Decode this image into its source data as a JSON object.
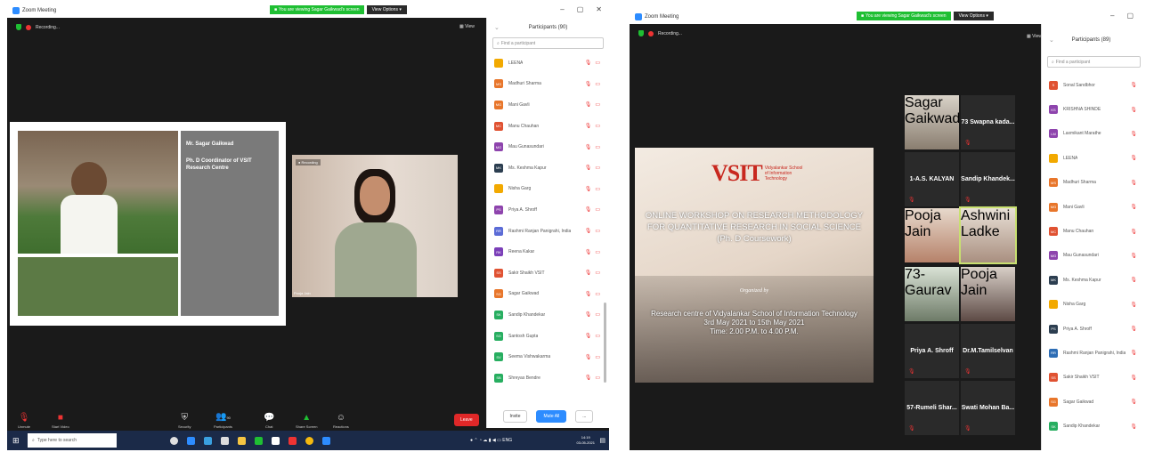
{
  "left": {
    "app_title": "Zoom Meeting",
    "share_banner": "You are viewing Sagar Gaikwad's screen",
    "view_options": "View Options",
    "recording": "Recording...",
    "view_btn": "View",
    "panel_title": "Participants (90)",
    "search_placeholder": "Find a participant",
    "participants": [
      {
        "initials": "",
        "name": "LEENA",
        "color": "#f2a900"
      },
      {
        "initials": "MS",
        "name": "Madhuri Sharma",
        "color": "#e8762b"
      },
      {
        "initials": "MG",
        "name": "Mani Gavli",
        "color": "#e8762b"
      },
      {
        "initials": "MC",
        "name": "Manu Chauhan",
        "color": "#e05232"
      },
      {
        "initials": "MG",
        "name": "Mau Gunasundari",
        "color": "#8e44ad"
      },
      {
        "initials": "MK",
        "name": "Ms. Keshma Kapur",
        "color": "#2c3e50"
      },
      {
        "initials": "",
        "name": "Nisha Garg",
        "color": "#f2a900"
      },
      {
        "initials": "PS",
        "name": "Priya A. Shroff",
        "color": "#8e44ad"
      },
      {
        "initials": "RR",
        "name": "Rashmi Ranjan Panigrahi, India",
        "color": "#5b6bd6"
      },
      {
        "initials": "RK",
        "name": "Reena Kakar",
        "color": "#7b3fb8"
      },
      {
        "initials": "SS",
        "name": "Sakir Shaikh VSIT",
        "color": "#e05232"
      },
      {
        "initials": "SG",
        "name": "Sagar Gaikwad",
        "color": "#e8762b"
      },
      {
        "initials": "SK",
        "name": "Sandip Khandekar",
        "color": "#27ae60"
      },
      {
        "initials": "SG",
        "name": "Santosh Gupta",
        "color": "#27ae60"
      },
      {
        "initials": "SV",
        "name": "Seema Vishwakarma",
        "color": "#27ae60"
      },
      {
        "initials": "SB",
        "name": "Shreyas Bendre",
        "color": "#27ae60"
      }
    ],
    "invite": "Invite",
    "mute_all": "Mute All",
    "more": "...",
    "speaker_name": "Mr. Sagar Gaikwad",
    "speaker_title": "Ph. D Coordinator of VSIT Research Centre",
    "pooja_label": "Pooja Jain",
    "toolbar": {
      "mute": "Unmute",
      "video": "Start Video",
      "security": "Security",
      "participants": "Participants",
      "participants_count": "90",
      "chat": "Chat",
      "share": "Share Screen",
      "reactions": "Reactions",
      "leave": "Leave"
    },
    "taskbar_search": "Type here to search",
    "clock_time": "14:19",
    "clock_date": "03-05-2021"
  },
  "right": {
    "app_title": "Zoom Meeting",
    "share_banner": "You are viewing Sagar Gaikwad's screen",
    "view_options": "View Options",
    "recording": "Recording...",
    "view_btn": "View",
    "panel_title": "Participants (89)",
    "search_placeholder": "Find a participant",
    "participants": [
      {
        "initials": "S",
        "name": "Sonal Sandbhor",
        "color": "#e05232"
      },
      {
        "initials": "KS",
        "name": "KRISHNA SHINDE",
        "color": "#8e44ad"
      },
      {
        "initials": "LM",
        "name": "Laxmikant Marathe",
        "color": "#8e44ad"
      },
      {
        "initials": "",
        "name": "LEENA",
        "color": "#f2a900"
      },
      {
        "initials": "MS",
        "name": "Madhuri Sharma",
        "color": "#e8762b"
      },
      {
        "initials": "MG",
        "name": "Mani Gavli",
        "color": "#e8762b"
      },
      {
        "initials": "MC",
        "name": "Manu Chauhan",
        "color": "#e05232"
      },
      {
        "initials": "MG",
        "name": "Mau Gunasundari",
        "color": "#8e44ad"
      },
      {
        "initials": "MK",
        "name": "Ms. Keshma Kapur",
        "color": "#2c3e50"
      },
      {
        "initials": "",
        "name": "Nisha Garg",
        "color": "#f2a900"
      },
      {
        "initials": "PS",
        "name": "Priya A. Shroff",
        "color": "#2c3e50"
      },
      {
        "initials": "RR",
        "name": "Rashmi Ranjan Panigrahi, India",
        "color": "#2d6db5"
      },
      {
        "initials": "SS",
        "name": "Sakir Shaikh VSIT",
        "color": "#e05232"
      },
      {
        "initials": "SG",
        "name": "Sagar Gaikwad",
        "color": "#e8762b"
      },
      {
        "initials": "SK",
        "name": "Sandip Khandekar",
        "color": "#27ae60"
      }
    ],
    "slide": {
      "logo": "VSIT",
      "logo_sub": "Vidyalankar School of Information Technology",
      "line1": "ONLINE WORKSHOP ON RESEARCH METHODOLOGY",
      "line2": "FOR QUANTITATIVE RESEARCH IN SOCIAL SCIENCE",
      "line3": "(Ph. D Coursework)",
      "organized": "Organized by",
      "org": "Research centre of Vidyalankar School of Information Technology",
      "dates": "3rd May 2021 to 15th May 2021",
      "time": "Time: 2.00 P.M. to 4.00 P.M."
    },
    "tiles": {
      "swapna": "73 Swapna kada...",
      "kalyan": "1-A.S. KALYAN",
      "sandip": "Sandip Khandek...",
      "priya": "Priya A. Shroff",
      "tamil": "Dr.M.Tamilselvan",
      "rumeli": "57-Rumeli Shar...",
      "swati": "Swati Mohan Ba...",
      "sagar_label": "Sagar Gaikwad",
      "pooja_label": "Pooja Jain",
      "ashwini_label": "Ashwini Ladke",
      "gaurav_label": "73-Gaurav",
      "pooja2_label": "Pooja Jain"
    }
  }
}
